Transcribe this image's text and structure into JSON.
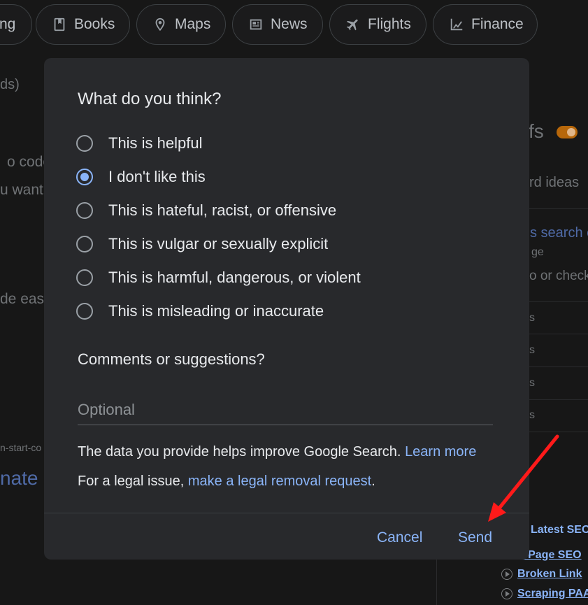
{
  "nav_chips": [
    {
      "label": "ng",
      "icon": "none"
    },
    {
      "label": "Books",
      "icon": "book-icon"
    },
    {
      "label": "Maps",
      "icon": "map-pin-icon"
    },
    {
      "label": "News",
      "icon": "newspaper-icon"
    },
    {
      "label": "Flights",
      "icon": "airplane-icon"
    },
    {
      "label": "Finance",
      "icon": "finance-chart-icon"
    }
  ],
  "background": {
    "left_fragments": [
      "ds)",
      "o code",
      "u want",
      "de eas",
      "n-start-co",
      "nate"
    ],
    "right_fragments": [
      "fs",
      "rd ideas",
      "s search c",
      "ge",
      "o or check",
      "s",
      "s",
      "s",
      "s",
      "s"
    ],
    "right_links": [
      "Latest SEO",
      "n-Page SEO",
      "Broken Link",
      "Scraping PAA"
    ]
  },
  "dialog": {
    "title": "What do you think?",
    "options": [
      {
        "label": "This is helpful",
        "checked": false
      },
      {
        "label": "I don't like this",
        "checked": true
      },
      {
        "label": "This is hateful, racist, or offensive",
        "checked": false
      },
      {
        "label": "This is vulgar or sexually explicit",
        "checked": false
      },
      {
        "label": "This is harmful, dangerous, or violent",
        "checked": false
      },
      {
        "label": "This is misleading or inaccurate",
        "checked": false
      }
    ],
    "comments_label": "Comments or suggestions?",
    "comments_placeholder": "Optional",
    "comments_value": "",
    "info_text": "The data you provide helps improve Google Search.",
    "learn_more": "Learn more",
    "legal_prefix": "For a legal issue,",
    "legal_link": "make a legal removal request",
    "legal_suffix": ".",
    "cancel_label": "Cancel",
    "send_label": "Send"
  },
  "colors": {
    "accent": "#8ab4f8",
    "dialog_bg": "#28292c",
    "page_bg": "#171717",
    "annotation_arrow": "#ff1a1a",
    "toggle": "#b7670a"
  }
}
